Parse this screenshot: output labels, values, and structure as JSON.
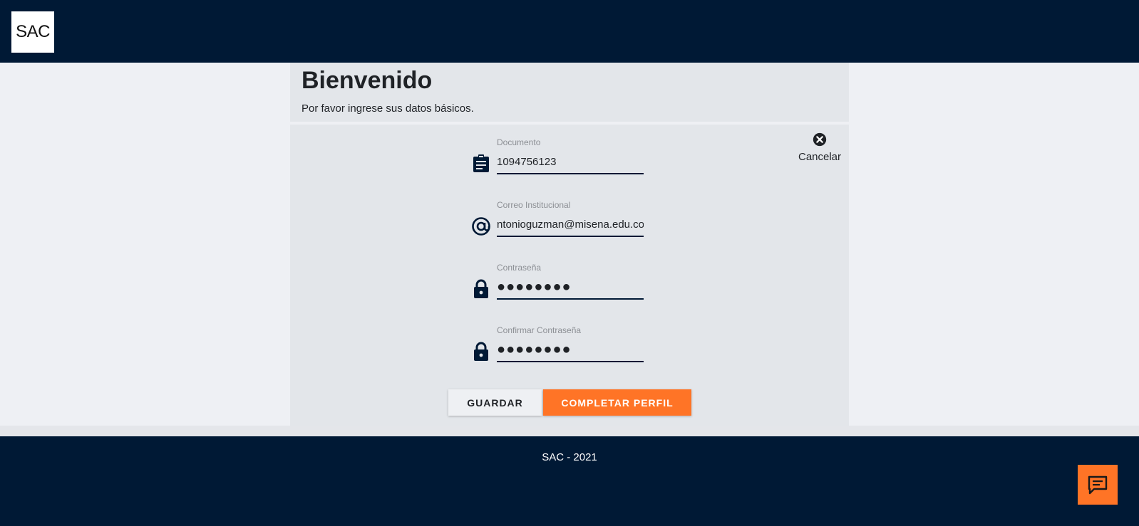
{
  "header": {
    "logo_text": "SAC"
  },
  "welcome": {
    "title": "Bienvenido",
    "subtitle": "Por favor ingrese sus datos básicos."
  },
  "form": {
    "cancel_label": "Cancelar",
    "fields": [
      {
        "label": "Documento",
        "value": "1094756123",
        "icon": "clipboard-icon"
      },
      {
        "label": "Correo Institucional",
        "value": "ntonioguzman@misena.edu.co",
        "icon": "at-sign-icon"
      },
      {
        "label": "Contraseña",
        "value": "●●●●●●●●",
        "icon": "lock-icon"
      },
      {
        "label": "Confirmar Contraseña",
        "value": "●●●●●●●●",
        "icon": "lock-icon"
      }
    ],
    "save_label": "GUARDAR",
    "complete_label": "COMPLETAR PERFIL"
  },
  "footer": {
    "text": "SAC - 2021"
  },
  "chat": {
    "icon": "chat-icon"
  },
  "colors": {
    "navy": "#001935",
    "accent": "#ff7426",
    "card": "#e3e6ea",
    "page": "#eef0f4"
  }
}
